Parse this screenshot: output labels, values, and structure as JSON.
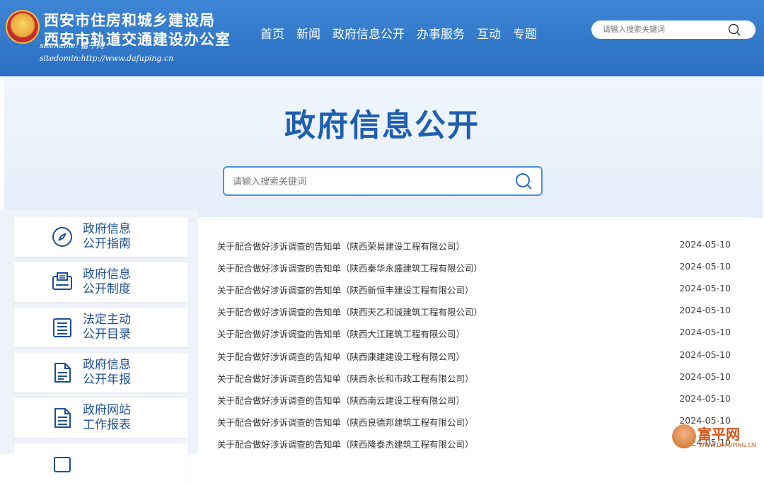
{
  "header": {
    "title_line1": "西安市住房和城乡建设局",
    "title_line2": "西安市轨道交通建设办公室",
    "sitename": "sitename: 富平网",
    "sitedomain": "sitedomin:http://www.dafuping.cn",
    "nav": [
      "首页",
      "新闻",
      "政府信息公开",
      "办事服务",
      "互动",
      "专题"
    ],
    "search_placeholder": "请输入搜索关键词"
  },
  "hero": {
    "title": "政府信息公开",
    "search_placeholder": "请输入搜索关键词"
  },
  "sidebar": {
    "items": [
      {
        "line1": "政府信息",
        "line2": "公开指南",
        "icon": "compass-icon"
      },
      {
        "line1": "政府信息",
        "line2": "公开制度",
        "icon": "document-panel-icon"
      },
      {
        "line1": "法定主动",
        "line2": "公开目录",
        "icon": "list-icon"
      },
      {
        "line1": "政府信息",
        "line2": "公开年报",
        "icon": "report-icon"
      },
      {
        "line1": "政府网站",
        "line2": "工作报表",
        "icon": "report-sheet-icon"
      }
    ]
  },
  "list": {
    "rows": [
      {
        "title": "关于配合做好涉诉调查的告知单（陕西荣易建设工程有限公司）",
        "date": "2024-05-10"
      },
      {
        "title": "关于配合做好涉诉调查的告知单（陕西秦华永盛建筑工程有限公司）",
        "date": "2024-05-10"
      },
      {
        "title": "关于配合做好涉诉调查的告知单（陕西新恒丰建设工程有限公司）",
        "date": "2024-05-10"
      },
      {
        "title": "关于配合做好涉诉调查的告知单（陕西天乙和诚建筑工程有限公司）",
        "date": "2024-05-10"
      },
      {
        "title": "关于配合做好涉诉调查的告知单（陕西大江建筑工程有限公司）",
        "date": "2024-05-10"
      },
      {
        "title": "关于配合做好涉诉调查的告知单（陕西康建建设工程有限公司）",
        "date": "2024-05-10"
      },
      {
        "title": "关于配合做好涉诉调查的告知单（陕西永长和市政工程有限公司）",
        "date": "2024-05-10"
      },
      {
        "title": "关于配合做好涉诉调查的告知单（陕西南云建设工程有限公司）",
        "date": "2024-05-10"
      },
      {
        "title": "关于配合做好涉诉调查的告知单（陕西良德邦建筑工程有限公司）",
        "date": "2024-05-10"
      },
      {
        "title": "关于配合做好涉诉调查的告知单（陕西隆泰杰建筑工程有限公司）",
        "date": "2024-05-10"
      }
    ]
  },
  "watermark": {
    "brand": "富平网",
    "domain": "WWW.DAFUPING.CN"
  },
  "colors": {
    "header_blue": "#2b6fc2",
    "title_blue": "#1e5fb1",
    "sidebar_text": "#1d4f93"
  }
}
